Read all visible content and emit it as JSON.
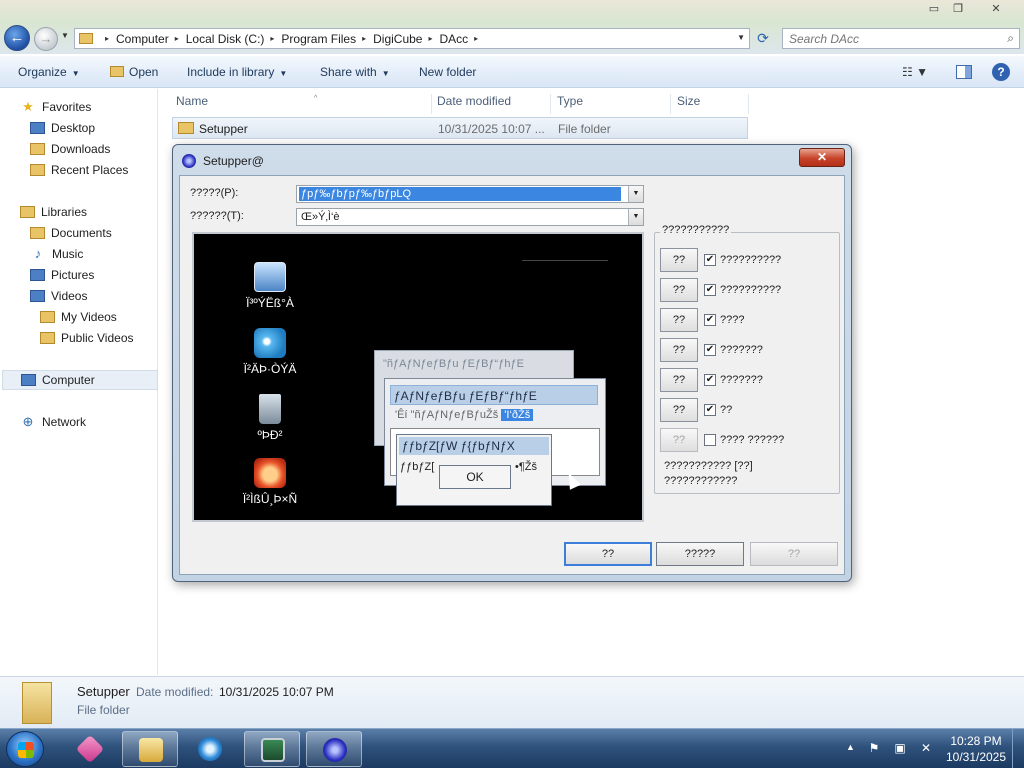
{
  "window": {
    "min_glyph": "▭",
    "max_glyph": "❐",
    "close_glyph": "✕"
  },
  "nav": {
    "back_glyph": "←",
    "forward_glyph": "→",
    "recent_glyph": "▼"
  },
  "address": {
    "crumbs": [
      "Computer",
      "Local Disk (C:)",
      "Program Files",
      "DigiCube",
      "DAcc"
    ],
    "separator": "▸",
    "dropdown_glyph": "▼",
    "refresh_glyph": "⟳"
  },
  "search": {
    "placeholder": "Search DAcc",
    "icon_glyph": "⌕"
  },
  "toolbar": {
    "organize": "Organize",
    "open": "Open",
    "include_in_library": "Include in library",
    "share_with": "Share with",
    "new_folder": "New folder",
    "caret": "▼",
    "views_glyph": "☷ ▼",
    "help": "?"
  },
  "navpane": {
    "favorites": "Favorites",
    "desktop": "Desktop",
    "downloads": "Downloads",
    "recent_places": "Recent Places",
    "libraries": "Libraries",
    "documents": "Documents",
    "music": "Music",
    "pictures": "Pictures",
    "videos": "Videos",
    "my_videos": "My Videos",
    "public_videos": "Public Videos",
    "computer": "Computer",
    "network": "Network",
    "star_glyph": "★",
    "music_glyph": "♪",
    "network_glyph": "⊕"
  },
  "filelist": {
    "columns": [
      "Name",
      "Date modified",
      "Type",
      "Size"
    ],
    "sort_glyph": "^",
    "rows": [
      {
        "name": "Setupper",
        "date": "10/31/2025 10:07 ...",
        "type": "File folder",
        "size": ""
      }
    ]
  },
  "details": {
    "name": "Setupper",
    "date_label": "Date modified:",
    "date_value": "10/31/2025 10:07 PM",
    "type": "File folder"
  },
  "dialog": {
    "title": "Setupper@",
    "close_glyph": "✕",
    "label_p": "?????(P):",
    "label_t": "??????(T):",
    "combo_p_value": "ƒpƒ‰ƒbƒpƒ‰ƒbƒpLQ",
    "combo_t_value": "Œ»Ý‚Ì‘è",
    "combo_arrow": "▼",
    "preview": {
      "icon_computer": "Ï³ºÝËß­°À",
      "icon_face1": "Ï²ÄÞ·­ÒÝÄ",
      "icon_recycle": "ºÞÐ²",
      "icon_face2": "Ï²ÌßÛ¸Þ×Ñ",
      "mini_back_title": "\"ñƒAƒNƒeƒBƒu ƒEƒBƒ“ƒhƒE",
      "mini_mid_title": "ƒAƒNƒeƒBƒu ƒEƒBƒ“ƒhƒE",
      "mini_mid_row_a": "'Êí   \"ñƒAƒNƒeƒBƒuŽš",
      "mini_mid_row_hl": "'I‘ðŽš",
      "mini_front_title": "ƒƒbƒZ[ƒW ƒ{ƒbƒNƒX",
      "mini_front_row": "ƒƒbƒZ[",
      "mini_front_row2": "•¶Žš",
      "ok": "OK"
    },
    "options": {
      "group_title": "???????????",
      "rows": [
        {
          "btn": "??",
          "checked": true,
          "label": "??????????"
        },
        {
          "btn": "??",
          "checked": true,
          "label": "??????????"
        },
        {
          "btn": "??",
          "checked": true,
          "label": "????"
        },
        {
          "btn": "??",
          "checked": true,
          "label": "???????"
        },
        {
          "btn": "??",
          "checked": true,
          "label": "???????"
        },
        {
          "btn": "??",
          "checked": true,
          "label": "??"
        },
        {
          "btn": "??",
          "checked": false,
          "label": "???? ??????"
        }
      ],
      "check_glyph": "✔",
      "note1": "??????????? [??]",
      "note2": "????????????"
    },
    "buttons": [
      "??",
      "?????",
      "??"
    ]
  },
  "taskbar": {
    "tray_arrow": "▲",
    "tray_flag_glyph": "⚑",
    "tray_net_glyph": "▣",
    "tray_vol_glyph": "✕",
    "time": "10:28 PM",
    "date": "10/31/2025"
  }
}
